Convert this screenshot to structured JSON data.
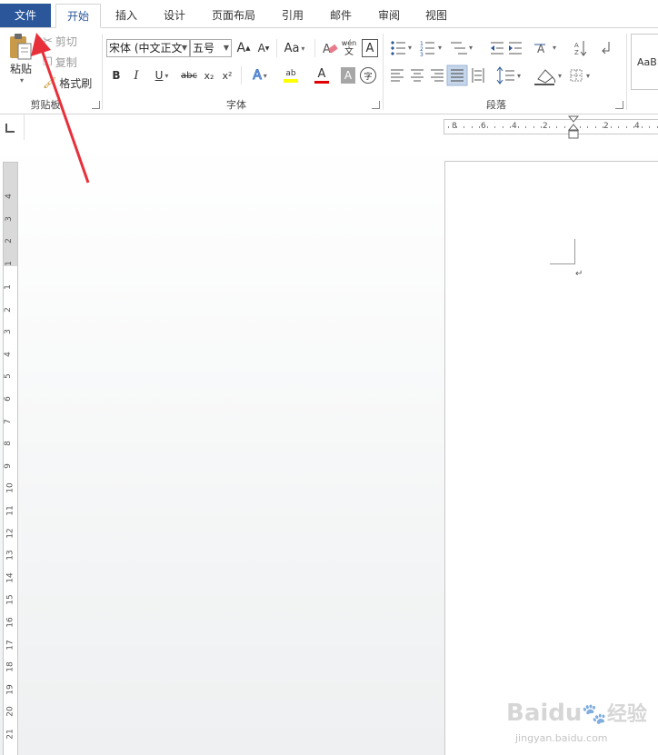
{
  "tabs": {
    "file": "文件",
    "home": "开始",
    "insert": "插入",
    "design": "设计",
    "layout": "页面布局",
    "references": "引用",
    "mailings": "邮件",
    "review": "审阅",
    "view": "视图"
  },
  "clipboard": {
    "paste": "粘贴",
    "cut": "剪切",
    "copy": "复制",
    "format_painter": "格式刷",
    "group_label": "剪贴板"
  },
  "font": {
    "font_name": "宋体 (中文正文",
    "font_size": "五号",
    "grow": "A",
    "shrink": "A",
    "change_case": "Aa",
    "phonetic_top": "wén",
    "phonetic_bottom": "文",
    "border_char": "A",
    "bold": "B",
    "italic": "I",
    "underline": "U",
    "strikethrough": "abc",
    "subscript": "x₂",
    "superscript": "x²",
    "text_effects": "A",
    "highlight": "ab",
    "font_color": "A",
    "char_shading": "A",
    "enclose_char": "字",
    "group_label": "字体"
  },
  "paragraph": {
    "group_label": "段落"
  },
  "styles": {
    "sample": "AaB"
  },
  "rulers": {
    "h_left": [
      "8",
      "6",
      "4",
      "2"
    ],
    "h_right": [
      "2",
      "4"
    ],
    "v_top": [
      "4",
      "3",
      "2",
      "1"
    ],
    "v_bottom": [
      "1",
      "2",
      "3",
      "4",
      "5",
      "6",
      "7",
      "8",
      "9",
      "10",
      "11",
      "12",
      "13",
      "14",
      "15",
      "16",
      "17",
      "18",
      "19",
      "20",
      "21"
    ]
  },
  "document": {
    "paragraph_mark": "↵"
  },
  "watermark": {
    "brand": "Baidu",
    "cn": "经验",
    "url": "jingyan.baidu.com"
  },
  "colors": {
    "file_tab": "#2b579a",
    "active_tab_text": "#2b579a",
    "annotation_arrow": "#e8303a",
    "highlight_yellow": "#ffff00",
    "font_color_red": "#e00000",
    "selected_button": "#c5d5ea"
  }
}
